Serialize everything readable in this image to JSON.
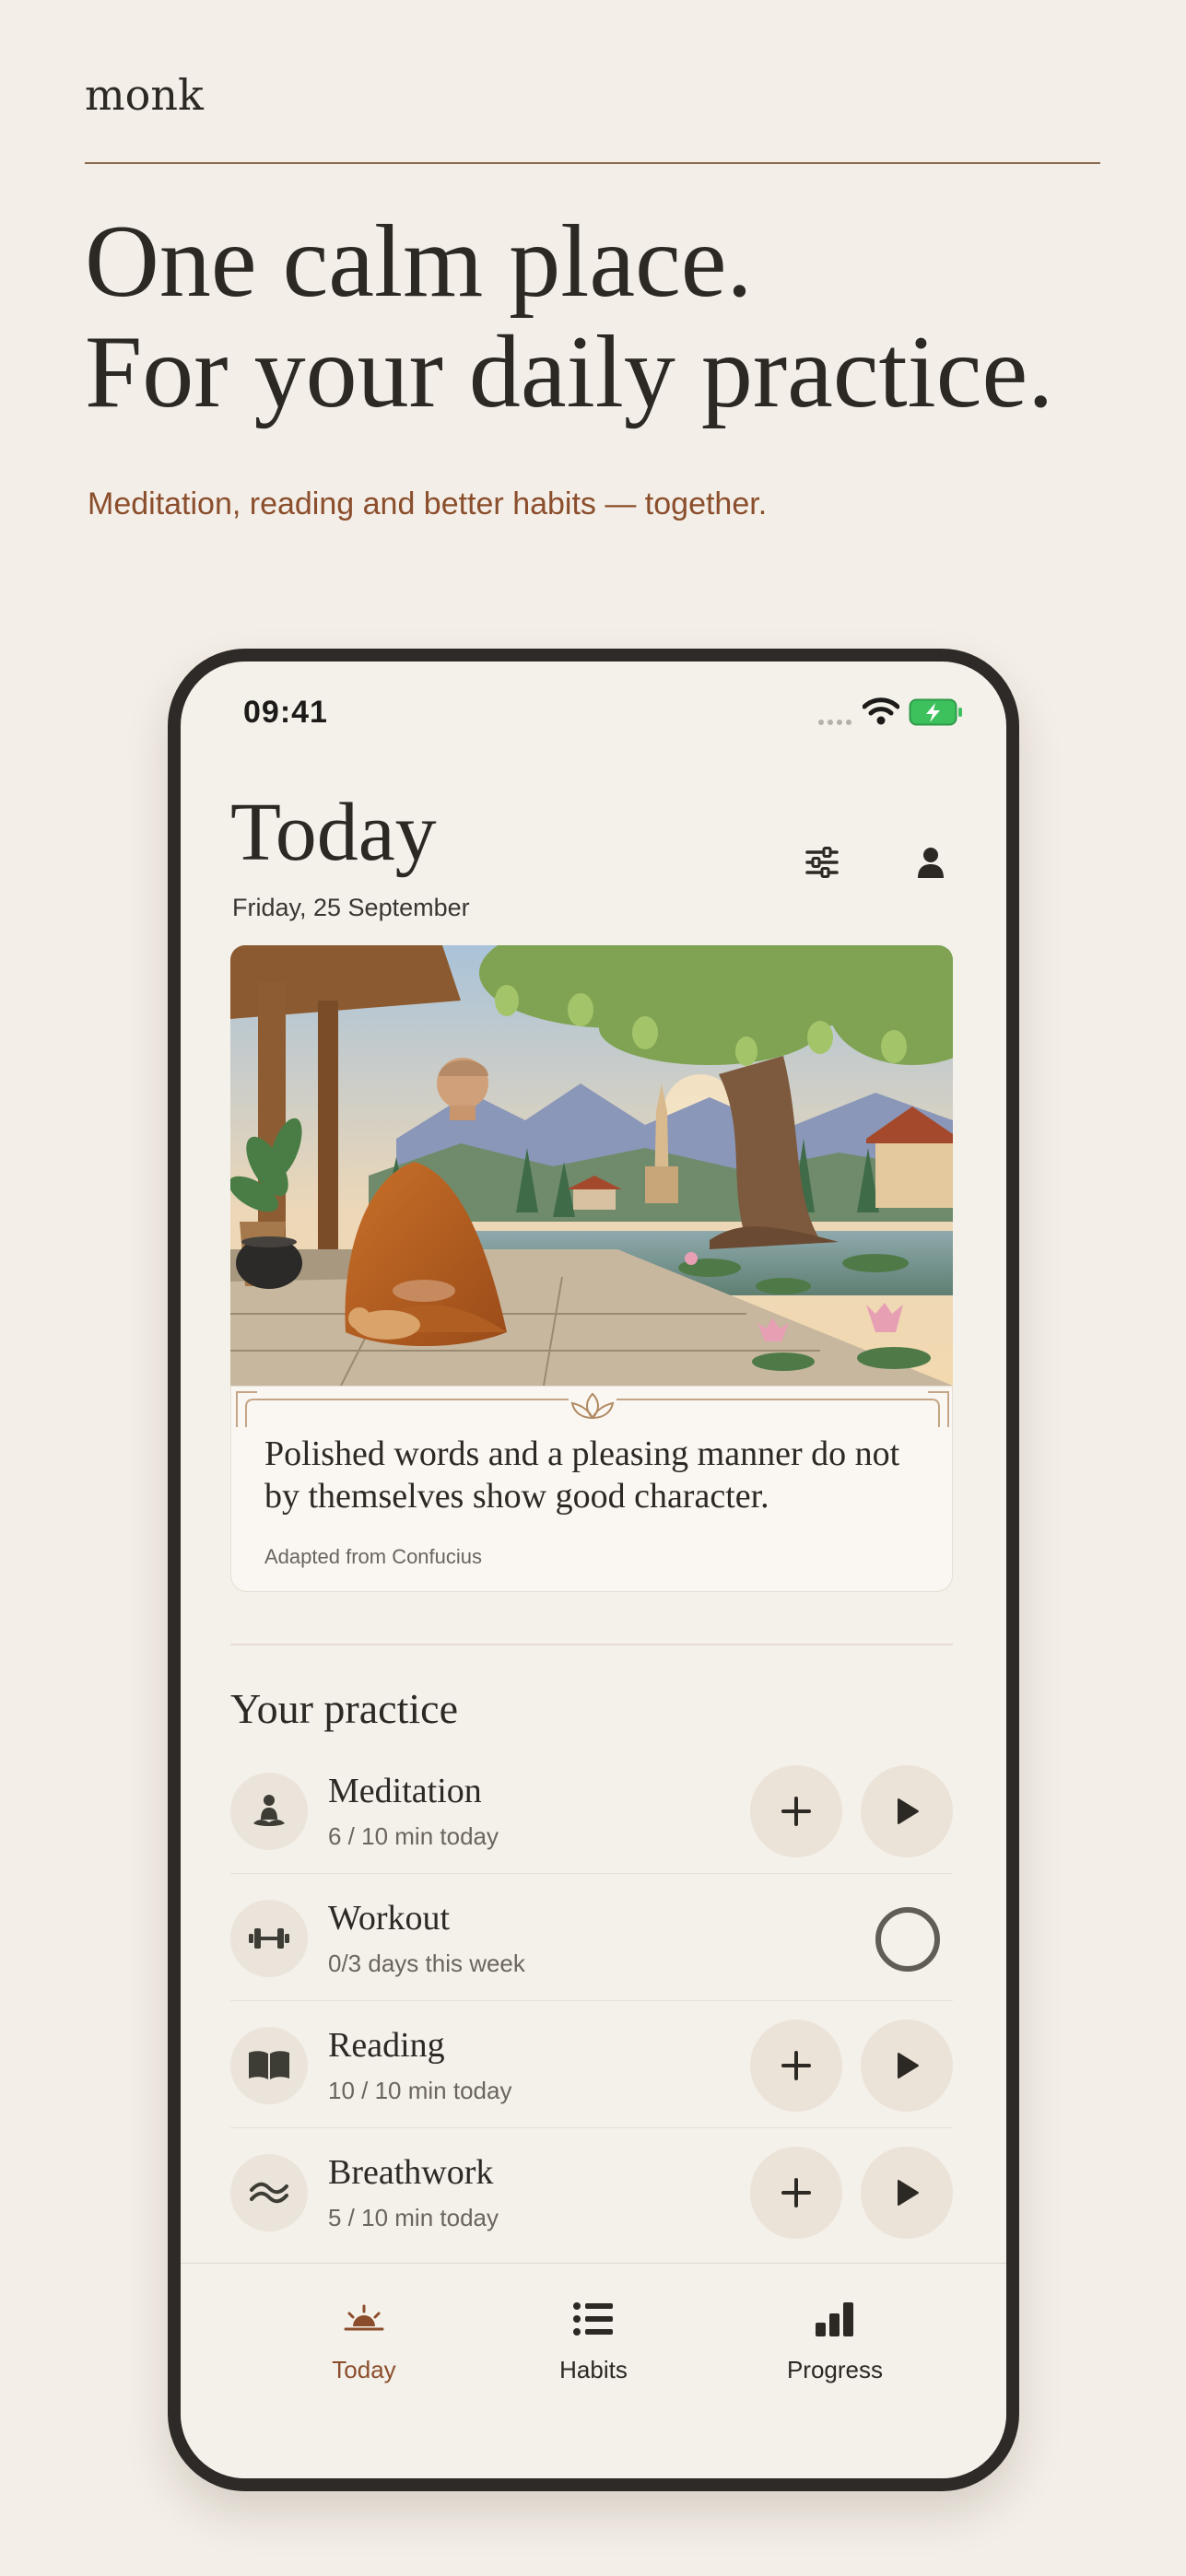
{
  "brand": "monk",
  "headline": {
    "line1": "One calm place.",
    "line2": "For your daily practice."
  },
  "tagline": "Meditation, reading and better habits — together.",
  "status_bar": {
    "time": "09:41"
  },
  "today": {
    "title": "Today",
    "date": "Friday, 25 September"
  },
  "quote": {
    "text": "Polished words and a pleasing manner do not by themselves show good character.",
    "source": "Adapted from Confucius"
  },
  "practice": {
    "title": "Your practice",
    "habits": [
      {
        "name": "Meditation",
        "progress": "6 / 10 min today",
        "icon": "meditation-icon"
      },
      {
        "name": "Workout",
        "progress": "0/3 days this week",
        "icon": "dumbbell-icon"
      },
      {
        "name": "Reading",
        "progress": "10 / 10 min today",
        "icon": "book-icon"
      },
      {
        "name": "Breathwork",
        "progress": "5 / 10 min today",
        "icon": "wave-icon"
      }
    ]
  },
  "tabs": [
    {
      "label": "Today",
      "icon": "sunrise-icon",
      "active": true
    },
    {
      "label": "Habits",
      "icon": "list-icon",
      "active": false
    },
    {
      "label": "Progress",
      "icon": "bar-chart-icon",
      "active": false
    }
  ],
  "colors": {
    "background": "#f3eee7",
    "accent": "#8b4e2c",
    "text": "#2c2823",
    "phone_frame": "#2d2a27"
  }
}
